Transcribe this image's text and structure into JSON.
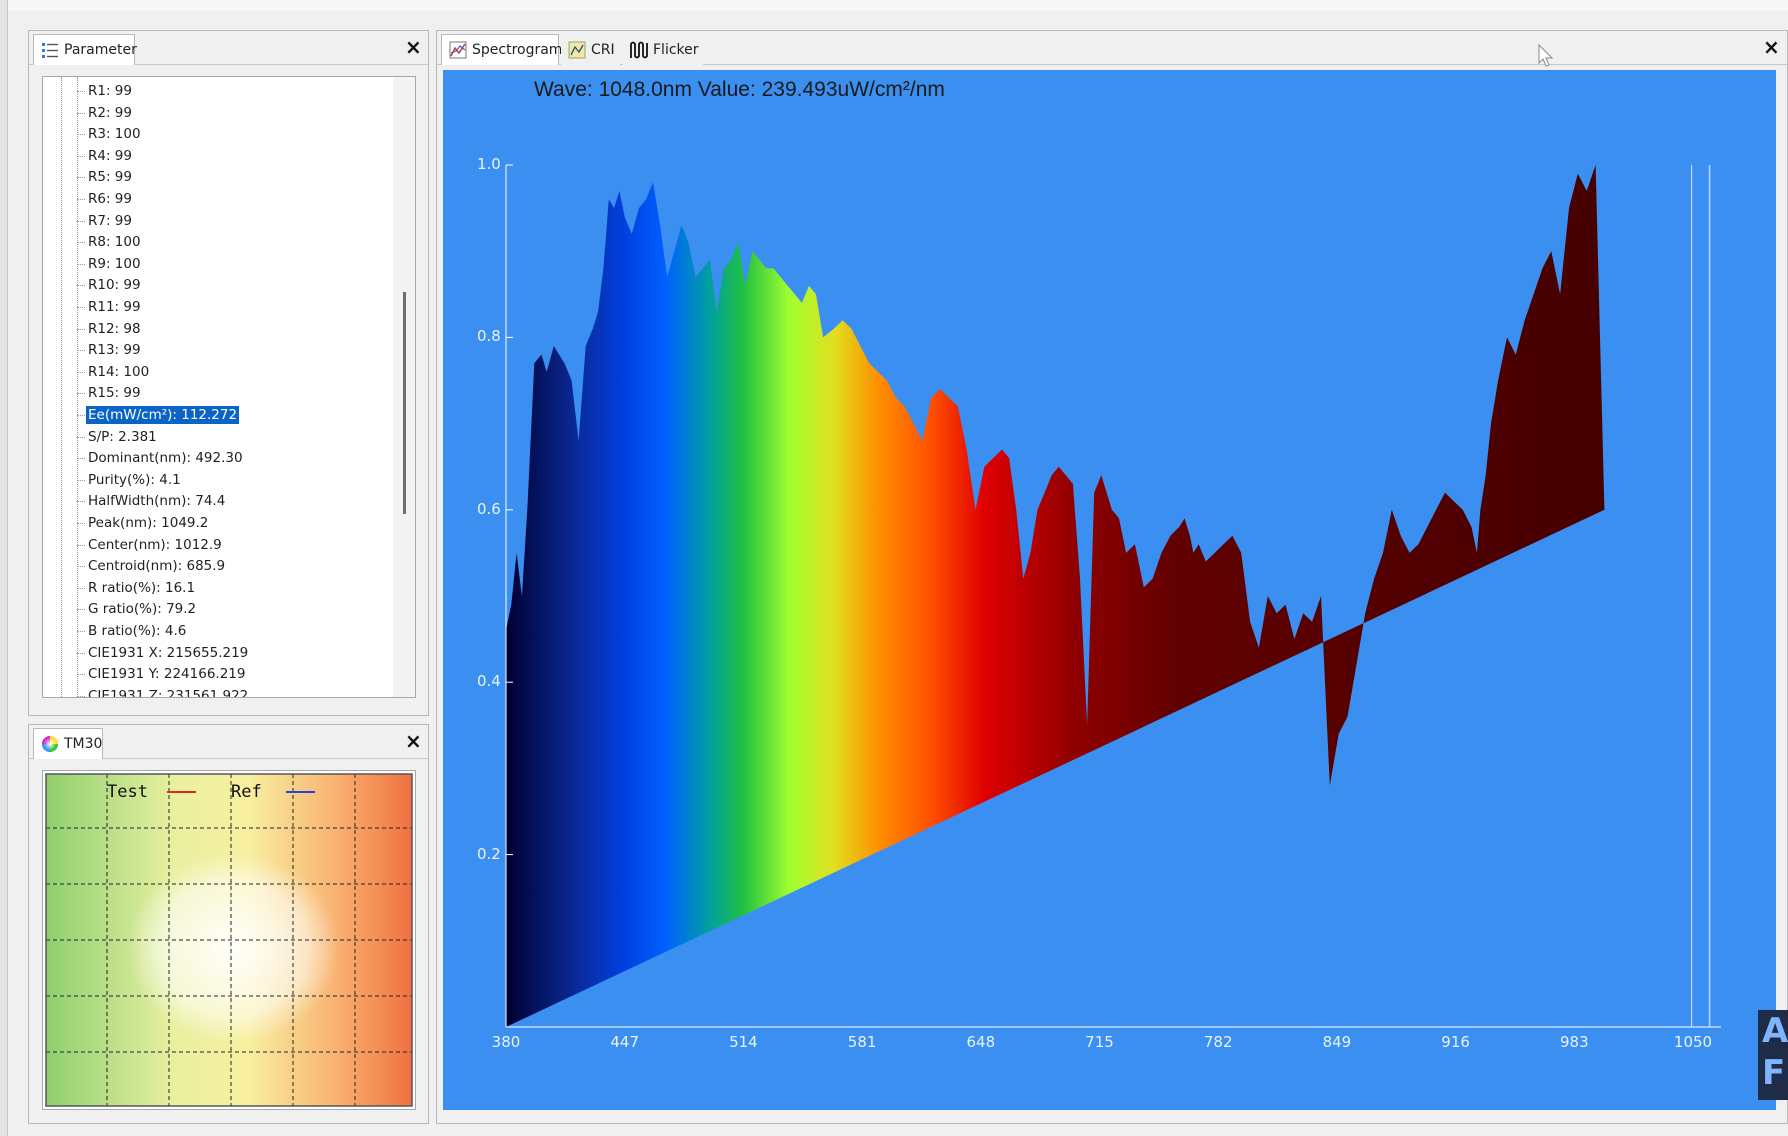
{
  "param_panel": {
    "tab_label": "Parameter",
    "close": "×",
    "items": [
      "R1: 99",
      "R2: 99",
      "R3: 100",
      "R4: 99",
      "R5: 99",
      "R6: 99",
      "R7: 99",
      "R8: 100",
      "R9: 100",
      "R10: 99",
      "R11: 99",
      "R12: 98",
      "R13: 99",
      "R14: 100",
      "R15: 99",
      "Ee(mW/cm²): 112.272",
      "S/P: 2.381",
      "Dominant(nm): 492.30",
      "Purity(%): 4.1",
      "HalfWidth(nm): 74.4",
      "Peak(nm): 1049.2",
      "Center(nm): 1012.9",
      "Centroid(nm): 685.9",
      "R ratio(%): 16.1",
      "G ratio(%): 79.2",
      "B ratio(%): 4.6",
      "CIE1931 X: 215655.219",
      "CIE1931 Y: 224166.219",
      "CIE1931 Z: 231561.922"
    ],
    "selected_index": 15
  },
  "tm30_panel": {
    "tab_label": "TM30",
    "close": "×",
    "legend_test": "Test",
    "legend_ref": "Ref",
    "test_color": "#e0281e",
    "ref_color": "#1e46dc"
  },
  "spectrum_panel": {
    "tabs": [
      "Spectrogram",
      "CRI",
      "Flicker"
    ],
    "active_tab": "Spectrogram",
    "close": "×",
    "readout": "Wave: 1048.0nm Value: 239.493uW/cm²/nm",
    "background": "#3a8ff0"
  },
  "chart_data": {
    "type": "area",
    "x_ticks": [
      "380",
      "447",
      "514",
      "581",
      "648",
      "715",
      "782",
      "849",
      "916",
      "983",
      "1050"
    ],
    "y_ticks": [
      "1.0",
      "0.8",
      "0.6",
      "0.4",
      "0.2"
    ],
    "xlim": [
      380,
      1050
    ],
    "ylim": [
      0,
      1.0
    ],
    "x": [
      380,
      383,
      386,
      389,
      392,
      396,
      400,
      403,
      407,
      410,
      413,
      417,
      421,
      425,
      429,
      432,
      435,
      438,
      441,
      444,
      447,
      451,
      455,
      459,
      463,
      467,
      471,
      475,
      479,
      483,
      487,
      491,
      495,
      499,
      503,
      507,
      511,
      515,
      519,
      523,
      527,
      531,
      535,
      539,
      543,
      547,
      551,
      555,
      559,
      565,
      570,
      575,
      580,
      585,
      590,
      595,
      600,
      605,
      610,
      615,
      620,
      625,
      630,
      635,
      640,
      645,
      650,
      655,
      660,
      664,
      668,
      672,
      676,
      680,
      684,
      688,
      692,
      696,
      700,
      704,
      708,
      712,
      716,
      719,
      722,
      726,
      730,
      735,
      740,
      745,
      750,
      755,
      760,
      763,
      766,
      768,
      771,
      775,
      780,
      785,
      790,
      795,
      800,
      805,
      810,
      815,
      820,
      825,
      830,
      835,
      840,
      845,
      850,
      855,
      860,
      865,
      870,
      875,
      880,
      885,
      890,
      895,
      900,
      905,
      910,
      915,
      920,
      925,
      928,
      930,
      933,
      936,
      940,
      945,
      950,
      955,
      960,
      965,
      970,
      975,
      980,
      985,
      990,
      995,
      1000,
      1005,
      1010,
      1015,
      1020,
      1025,
      1030,
      1035,
      1040,
      1043,
      1045,
      1046,
      1047,
      1048,
      1049,
      1049.2,
      1050
    ],
    "y": [
      0.46,
      0.49,
      0.55,
      0.5,
      0.6,
      0.77,
      0.78,
      0.76,
      0.79,
      0.78,
      0.77,
      0.75,
      0.68,
      0.79,
      0.81,
      0.83,
      0.88,
      0.96,
      0.95,
      0.97,
      0.94,
      0.92,
      0.95,
      0.96,
      0.98,
      0.93,
      0.87,
      0.9,
      0.93,
      0.91,
      0.87,
      0.88,
      0.89,
      0.83,
      0.88,
      0.89,
      0.91,
      0.86,
      0.9,
      0.89,
      0.88,
      0.88,
      0.87,
      0.86,
      0.85,
      0.84,
      0.86,
      0.85,
      0.8,
      0.81,
      0.82,
      0.81,
      0.79,
      0.77,
      0.76,
      0.75,
      0.73,
      0.72,
      0.7,
      0.68,
      0.73,
      0.74,
      0.73,
      0.72,
      0.67,
      0.6,
      0.65,
      0.66,
      0.67,
      0.66,
      0.6,
      0.52,
      0.55,
      0.6,
      0.62,
      0.64,
      0.65,
      0.64,
      0.63,
      0.52,
      0.35,
      0.62,
      0.64,
      0.62,
      0.6,
      0.59,
      0.55,
      0.56,
      0.51,
      0.52,
      0.55,
      0.57,
      0.58,
      0.59,
      0.57,
      0.55,
      0.56,
      0.54,
      0.55,
      0.56,
      0.57,
      0.55,
      0.47,
      0.44,
      0.5,
      0.48,
      0.49,
      0.45,
      0.48,
      0.47,
      0.5,
      0.28,
      0.34,
      0.36,
      0.42,
      0.48,
      0.52,
      0.55,
      0.6,
      0.57,
      0.55,
      0.56,
      0.58,
      0.6,
      0.62,
      0.61,
      0.6,
      0.58,
      0.55,
      0.6,
      0.64,
      0.7,
      0.75,
      0.8,
      0.78,
      0.82,
      0.85,
      0.88,
      0.9,
      0.85,
      0.95,
      0.99,
      0.97,
      1.0,
      0.6
    ],
    "peak_marker_x": 1049.2,
    "gradient_stops": [
      {
        "nm": 380,
        "color": "#000030"
      },
      {
        "nm": 420,
        "color": "#0a2a9a"
      },
      {
        "nm": 447,
        "color": "#0040e0"
      },
      {
        "nm": 470,
        "color": "#0060ff"
      },
      {
        "nm": 495,
        "color": "#00a0a0"
      },
      {
        "nm": 514,
        "color": "#20c040"
      },
      {
        "nm": 540,
        "color": "#a0ff30"
      },
      {
        "nm": 565,
        "color": "#e0e020"
      },
      {
        "nm": 590,
        "color": "#ff9000"
      },
      {
        "nm": 620,
        "color": "#ff5000"
      },
      {
        "nm": 650,
        "color": "#e00000"
      },
      {
        "nm": 700,
        "color": "#900000"
      },
      {
        "nm": 760,
        "color": "#600000"
      },
      {
        "nm": 1050,
        "color": "#400000"
      }
    ]
  }
}
